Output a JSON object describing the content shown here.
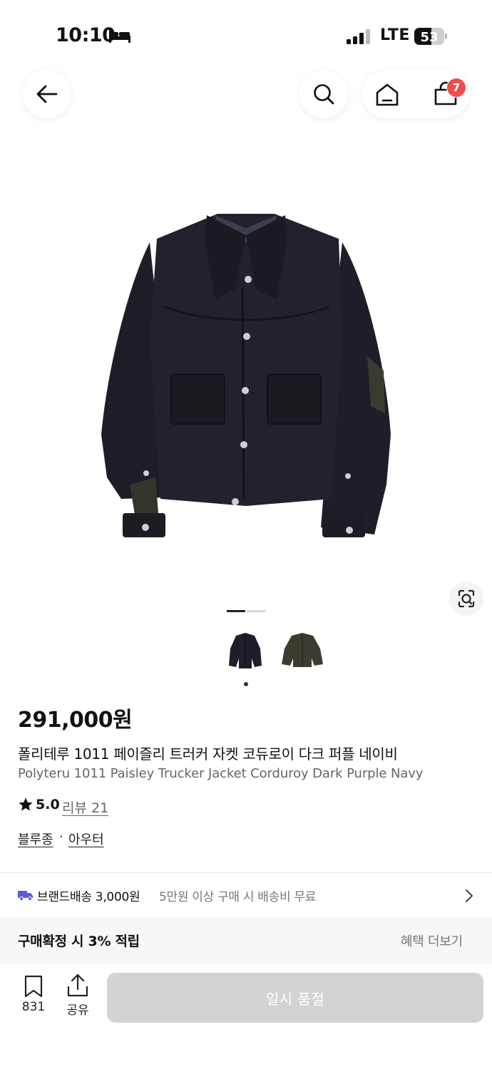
{
  "status_bar": {
    "time": "10:10",
    "network": "LTE",
    "battery": "53"
  },
  "header": {
    "cart_count": "7"
  },
  "product": {
    "price": "291,000원",
    "name_ko": "폴리테루 1011 페이즐리 트러커 자켓 코듀로이 다크 퍼플 네이비",
    "name_en": "Polyteru 1011 Paisley Trucker Jacket Corduroy Dark Purple Navy",
    "rating": "5.0",
    "review_label": "리뷰 21",
    "categories": [
      "블루종",
      "아우터"
    ],
    "category_separator": "·"
  },
  "shipping": {
    "label": "브랜드배송 3,000원",
    "note": "5만원 이상 구매 시 배송비 무료"
  },
  "benefit": {
    "label": "구매확정 시 3% 적립",
    "more": "혜택 더보기"
  },
  "bottom_bar": {
    "bookmark_count": "831",
    "share_label": "공유",
    "buy_label": "일시 품절"
  },
  "colors": {
    "badge": "#ee4e4e",
    "button_disabled": "#d3d3d3",
    "shipping_icon": "#5b5bd6"
  }
}
